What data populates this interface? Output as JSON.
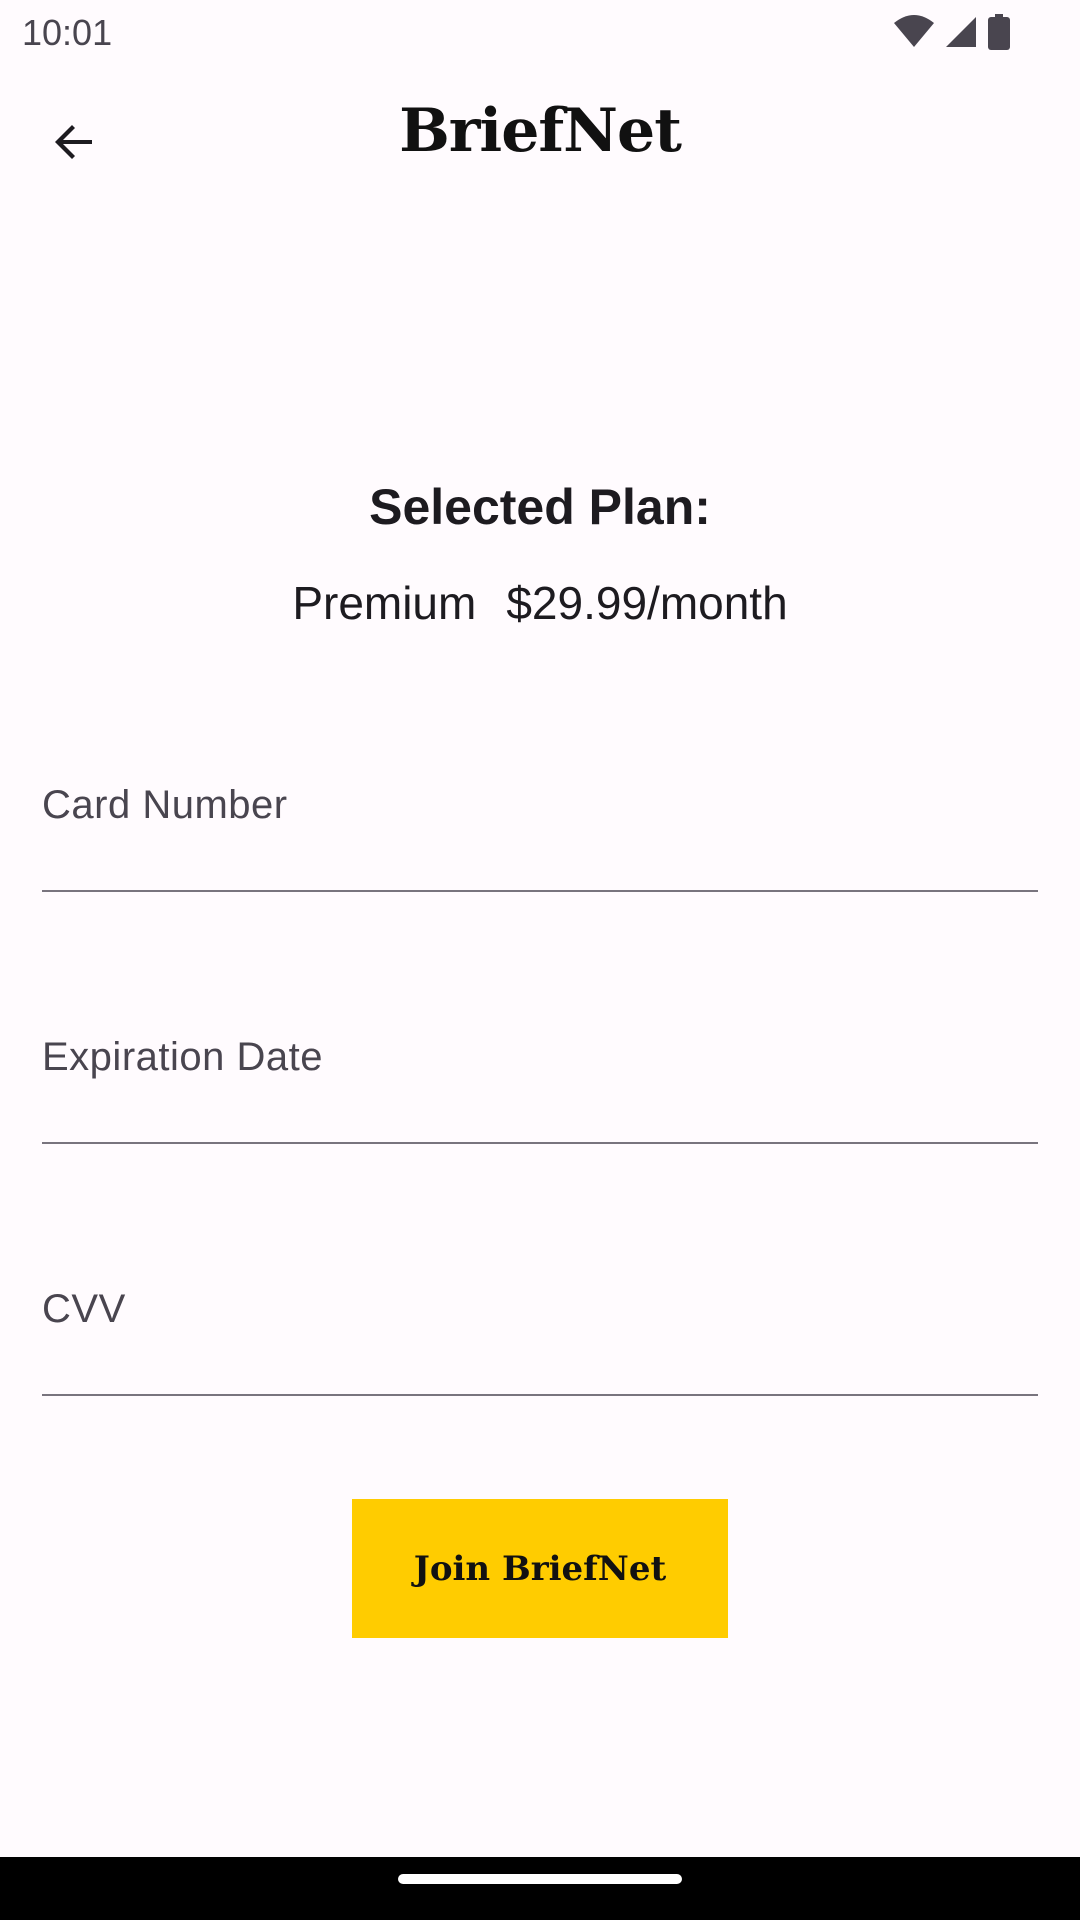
{
  "status_bar": {
    "time": "10:01",
    "icons": [
      "wifi-icon",
      "cellular-signal-icon",
      "battery-icon"
    ]
  },
  "app_bar": {
    "back_icon": "arrow-back-icon",
    "title": "BriefNet"
  },
  "plan": {
    "heading": "Selected Plan:",
    "name": "Premium",
    "price": "$29.99/month"
  },
  "form": {
    "card_number": {
      "label": "Card Number",
      "value": ""
    },
    "expiration_date": {
      "label": "Expiration Date",
      "value": ""
    },
    "cvv": {
      "label": "CVV",
      "value": ""
    }
  },
  "join_button": {
    "label": "Join BriefNet",
    "color": "#ffcc00"
  },
  "colors": {
    "background": "#fffbfe",
    "accent": "#ffcc00",
    "underline": "#79747e"
  }
}
